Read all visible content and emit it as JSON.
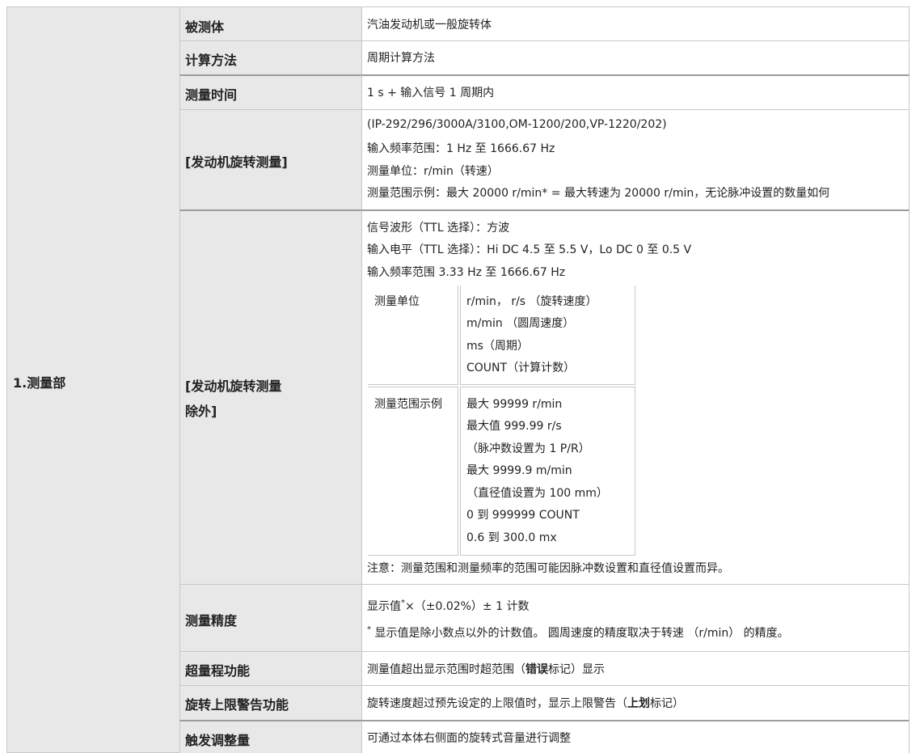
{
  "section": "1.测量部",
  "rows": {
    "r1": {
      "label": "被测体",
      "value": "汽油发动机或一般旋转体"
    },
    "r2": {
      "label": "计算方法",
      "value": "周期计算方法"
    },
    "r3": {
      "label": "测量时间",
      "value": "1 s + 输入信号 1 周期内"
    },
    "r4": {
      "label": "[发动机旋转测量]",
      "lines": [
        "(IP-292/296/3000A/3100,OM-1200/200,VP-1220/202)",
        "输入频率范围：1 Hz 至 1666.67 Hz",
        "测量单位：r/min（转速）",
        "测量范围示例：最大 20000 r/min* = 最大转速为 20000 r/min，无论脉冲设置的数量如何"
      ]
    },
    "r5": {
      "label_1": "[发动机旋转测量",
      "label_2": "除外]",
      "lines": [
        "信号波形（TTL 选择）：方波",
        "输入电平（TTL 选择）：Hi DC 4.5 至 5.5 V，Lo DC 0 至 0.5 V",
        "输入频率范围 3.33 Hz 至 1666.67 Hz"
      ],
      "unit_label": "测量单位",
      "unit_values": [
        "r/min， r/s （旋转速度）",
        "m/min （圆周速度）",
        "ms（周期）",
        "COUNT（计算计数）"
      ],
      "range_label": "测量范围示例",
      "range_values": [
        "最大 99999 r/min",
        "最大值 999.99 r/s",
        "（脉冲数设置为 1 P/R）",
        "最大 9999.9 m/min",
        "（直径值设置为 100 mm）",
        "0 到 999999 COUNT",
        "0.6 到 300.0 mx"
      ],
      "note": "注意：测量范围和测量频率的范围可能因脉冲数设置和直径值设置而异。"
    },
    "r6": {
      "label": "测量精度",
      "line1_a": "显示值",
      "line1_sup": "*",
      "line1_b": "×（±0.02%）± 1 计数",
      "line2_sup": "*",
      "line2": " 显示值是除小数点以外的计数值。 圆周速度的精度取决于转速 （r/min） 的精度。"
    },
    "r7": {
      "label": "超量程功能",
      "value_a": "测量值超出显示范围时超范围（",
      "value_bold": "错误",
      "value_b": "标记）显示"
    },
    "r8": {
      "label": "旋转上限警告功能",
      "value_a": "旋转速度超过预先设定的上限值时，显示上限警告（",
      "value_bold": "上划",
      "value_b": "标记）"
    },
    "r9": {
      "label": "触发调整量",
      "value": "可通过本体右侧面的旋转式音量进行调整"
    }
  }
}
